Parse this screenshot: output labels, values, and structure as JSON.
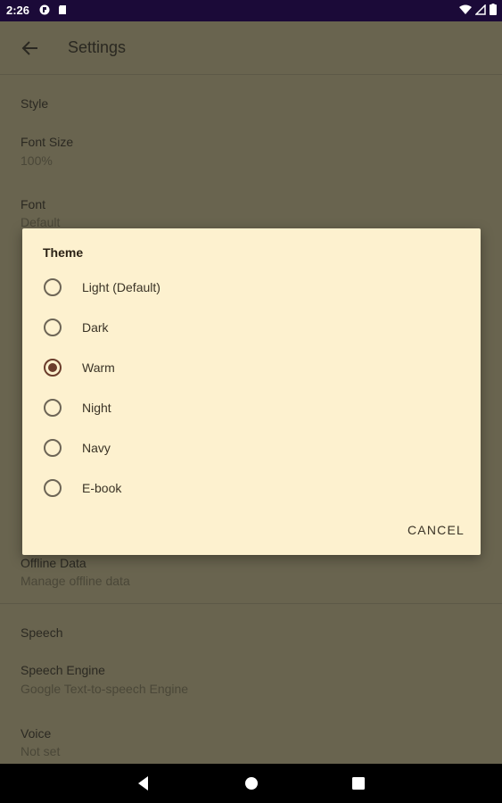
{
  "status_bar": {
    "time": "2:26"
  },
  "toolbar": {
    "title": "Settings"
  },
  "style_section": {
    "header": "Style",
    "font_size": {
      "title": "Font Size",
      "summary": "100%"
    },
    "font": {
      "title": "Font",
      "summary": "Default"
    }
  },
  "offline_section": {
    "offline_data": {
      "title": "Offline Data",
      "summary": "Manage offline data"
    }
  },
  "speech_section": {
    "header": "Speech",
    "speech_engine": {
      "title": "Speech Engine",
      "summary": "Google Text-to-speech Engine"
    },
    "voice": {
      "title": "Voice",
      "summary": "Not set"
    }
  },
  "dialog": {
    "title": "Theme",
    "options": [
      {
        "label": "Light (Default)",
        "selected": false
      },
      {
        "label": "Dark",
        "selected": false
      },
      {
        "label": "Warm",
        "selected": true
      },
      {
        "label": "Night",
        "selected": false
      },
      {
        "label": "Navy",
        "selected": false
      },
      {
        "label": "E-book",
        "selected": false
      }
    ],
    "cancel_label": "CANCEL"
  },
  "colors": {
    "status_bar": "#1b0a38",
    "dialog_bg": "#fdf1cf",
    "accent": "#6b3d2c",
    "scrim_bg": "#68634f"
  }
}
